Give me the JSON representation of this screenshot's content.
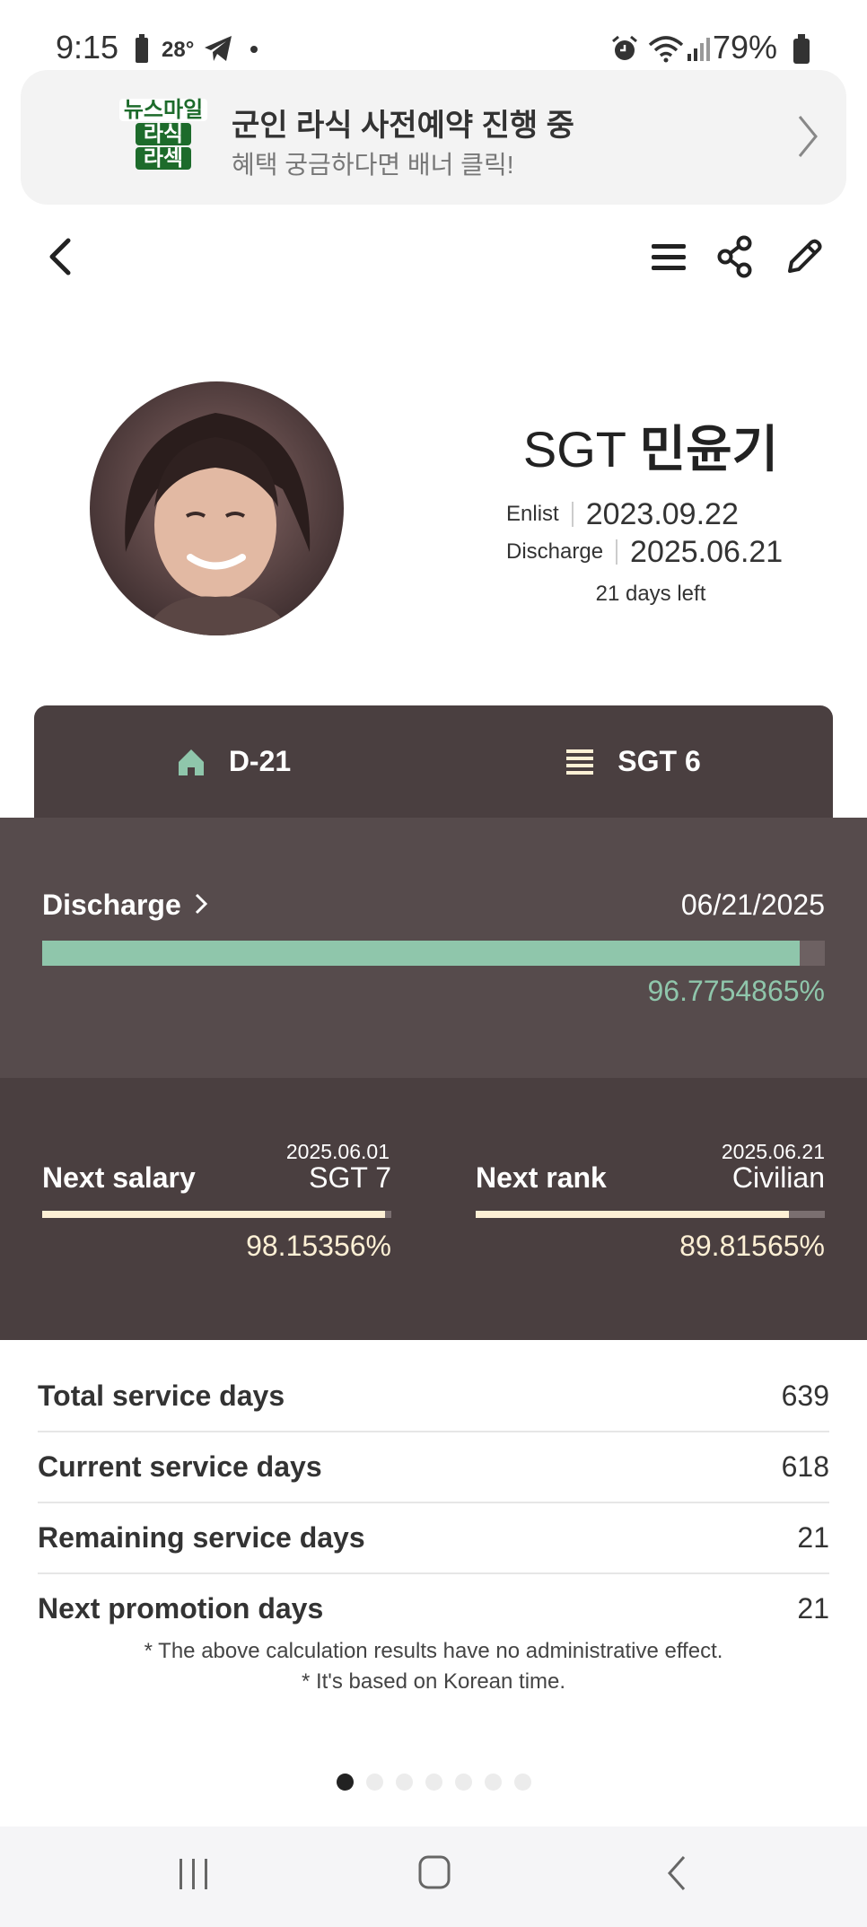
{
  "status_bar": {
    "time": "9:15",
    "temperature": "28°",
    "battery": "79%"
  },
  "banner": {
    "logo_lines": [
      "뉴스마일",
      "라식",
      "라섹"
    ],
    "title": "군인 라식 사전예약 진행 중",
    "subtitle": "혜택 궁금하다면 배너 클릭!"
  },
  "profile": {
    "rank": "SGT",
    "name": "민윤기",
    "enlist_label": "Enlist",
    "enlist_date": "2023.09.22",
    "discharge_label": "Discharge",
    "discharge_date": "2025.06.21",
    "days_left": "21 days left"
  },
  "tabs": [
    {
      "label": "D-21",
      "icon": "home-icon"
    },
    {
      "label": "SGT 6",
      "icon": "list-icon"
    }
  ],
  "discharge": {
    "title": "Discharge",
    "date": "06/21/2025",
    "percent_text": "96.7754865%",
    "progress": 0.967754865
  },
  "next_salary": {
    "title": "Next salary",
    "date": "2025.06.01",
    "value": "SGT 7",
    "percent_text": "98.15356%",
    "progress": 0.9815356
  },
  "next_rank": {
    "title": "Next rank",
    "date": "2025.06.21",
    "value": "Civilian",
    "percent_text": "89.81565%",
    "progress": 0.8981565
  },
  "stats": [
    {
      "label": "Total service days",
      "value": "639"
    },
    {
      "label": "Current service days",
      "value": "618"
    },
    {
      "label": "Remaining service days",
      "value": "21"
    },
    {
      "label": "Next promotion days",
      "value": "21"
    }
  ],
  "notes": [
    "* The above calculation results have no administrative effect.",
    "* It's based on Korean time."
  ],
  "pager": {
    "count": 7,
    "active": 0
  },
  "colors": {
    "tab_bg": "#4a3f40",
    "panel_bg": "#564b4c",
    "accent_green": "#8fc6ab",
    "cream": "#fdf0d5"
  }
}
